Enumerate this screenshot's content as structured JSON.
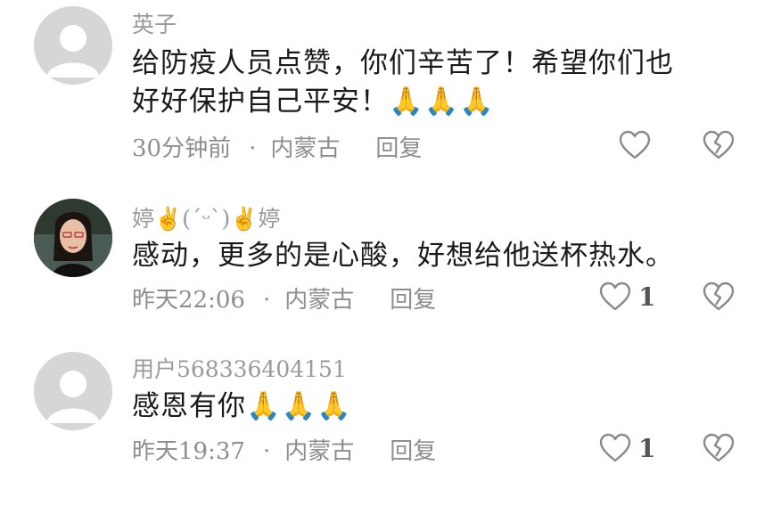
{
  "comments": [
    {
      "username": "英子",
      "text_line1": "给防疫人员点赞，你们辛苦了！希望你们也",
      "text_line2": "好好保护自己平安！",
      "text_emoji": "🙏🙏🙏",
      "time": "30分钟前",
      "separator": "·",
      "location": "内蒙古",
      "reply_label": "回复",
      "like_count": ""
    },
    {
      "username": "婷✌(ˊᵕˋ)✌婷",
      "text_line1": "感动，更多的是心酸，好想给他送杯热水。",
      "text_line2": "",
      "text_emoji": "",
      "time": "昨天22:06",
      "separator": "·",
      "location": "内蒙古",
      "reply_label": "回复",
      "like_count": "1"
    },
    {
      "username": "用户568336404151",
      "text_line1": "感恩有你",
      "text_line2": "",
      "text_emoji": "🙏🙏🙏",
      "time": "昨天19:37",
      "separator": "·",
      "location": "内蒙古",
      "reply_label": "回复",
      "like_count": "1"
    }
  ],
  "icons": {
    "like": "heart-outline-icon",
    "dislike": "broken-heart-icon",
    "avatar_default": "default-avatar-icon"
  },
  "colors": {
    "username": "#9a9a9a",
    "text": "#1a1a1a",
    "meta": "#8e8e8e",
    "icon_stroke": "#8a8a8a"
  }
}
